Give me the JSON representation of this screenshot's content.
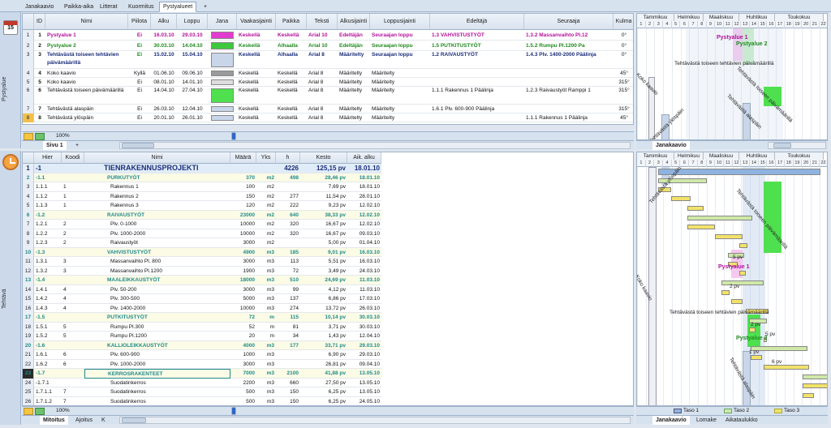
{
  "tabs": [
    "Janakaavio",
    "Paikka-aika",
    "Litterat",
    "Kuormitus",
    "Pystyalueet",
    "+"
  ],
  "active_tab": "Pystyalueet",
  "top_panel": {
    "side_label": "Pystyalue",
    "columns": [
      "ID",
      "Nimi",
      "Piilota",
      "Alku",
      "Loppu",
      "Jana",
      "Vaakasijainti",
      "Paikka",
      "Teksti",
      "Alkusijainti",
      "Loppusijainti",
      "Edeltäjä",
      "Seuraaja",
      "Kulma"
    ],
    "rows": [
      {
        "num": "1",
        "id": "1",
        "name": "Pystyalue 1",
        "hide": "Ei",
        "start": "16.03.10",
        "end": "29.03.10",
        "hpos": "Keskellä",
        "place": "Keskellä",
        "text": "Arial 10",
        "startpos": "Edeltäjän",
        "endpos": "Seuraajan loppu",
        "pred": "1.3  VAHVISTUSTYÖT",
        "succ": "1.3.2  Massanvaihto Pl.12",
        "angle": "0°",
        "style": "magenta",
        "jana": "#e23bd0"
      },
      {
        "num": "2",
        "id": "2",
        "name": "Pystyalue 2",
        "hide": "Ei",
        "start": "30.03.10",
        "end": "14.04.10",
        "hpos": "Keskellä",
        "place": "Alhaalla",
        "text": "Arial 10",
        "startpos": "Edeltäjän",
        "endpos": "Seuraajan loppu",
        "pred": "1.5  PUTKITUSTYÖT",
        "succ": "1.5.2  Rumpu Pl.1200  Pa",
        "angle": "0°",
        "style": "green",
        "jana": "#3ec83e"
      },
      {
        "num": "3",
        "id": "3",
        "name": "Tehtävästä toiseen tehtävien päivämäärillä",
        "hide": "Ei",
        "start": "15.02.10",
        "end": "15.04.10",
        "hpos": "Keskellä",
        "place": "Alhaalla",
        "text": "Arial 8",
        "startpos": "Määritelty",
        "endpos": "Seuraajan loppu",
        "pred": "1.2  RAIVAUSTYÖT",
        "succ": "1.4.3  Plv. 1400-2000  Päälinja",
        "angle": "0°",
        "style": "navy",
        "jana": "#c9d6ea"
      },
      {
        "num": "4",
        "id": "4",
        "name": "Koko kaavio",
        "hide": "Kyllä",
        "start": "01.06.10",
        "end": "09.06.10",
        "hpos": "Keskellä",
        "place": "Keskellä",
        "text": "Arial 8",
        "startpos": "Määritelty",
        "endpos": "Määritelty",
        "pred": "",
        "succ": "",
        "angle": "45°",
        "style": "",
        "jana": "#9a9a9a"
      },
      {
        "num": "5",
        "id": "5",
        "name": "Koko kaavio",
        "hide": "Ei",
        "start": "08.01.10",
        "end": "14.01.10",
        "hpos": "Keskellä",
        "place": "Keskellä",
        "text": "Arial 8",
        "startpos": "Määritelty",
        "endpos": "Määritelty",
        "pred": "",
        "succ": "",
        "angle": "315°",
        "style": "",
        "jana": "#ddd"
      },
      {
        "num": "6",
        "id": "6",
        "name": "Tehtävästä toiseen päivämäärillä",
        "hide": "Ei",
        "start": "14.04.10",
        "end": "27.04.10",
        "hpos": "Keskellä",
        "place": "Keskellä",
        "text": "Arial 8",
        "startpos": "Määritelty",
        "endpos": "Määritelty",
        "pred": "1.1.1  Rakennus 1  Päälinja",
        "succ": "1.2.3  Raivaustyöt  Ramppi 1",
        "angle": "315°",
        "style": "",
        "jana": "#4fe04f"
      },
      {
        "num": "7",
        "id": "7",
        "name": "Tehtävästä alaspäin",
        "hide": "Ei",
        "start": "26.03.10",
        "end": "12.04.10",
        "hpos": "Keskellä",
        "place": "Keskellä",
        "text": "Arial 8",
        "startpos": "Määritelty",
        "endpos": "Määritelty",
        "pred": "1.6.1  Plv. 600-900  Päälinja",
        "succ": "",
        "angle": "315°",
        "style": "",
        "jana": "#c9d6ea"
      },
      {
        "num": "8",
        "id": "8",
        "name": "Tehtävästä ylöspäin",
        "hide": "Ei",
        "start": "20.01.10",
        "end": "26.01.10",
        "hpos": "Keskellä",
        "place": "Keskellä",
        "text": "Arial 8",
        "startpos": "Määritelty",
        "endpos": "Määritelty",
        "pred": "",
        "succ": "1.1.1  Rakennus 1  Päälinja",
        "angle": "45°",
        "style": "",
        "jana": "#c9d6ea"
      }
    ],
    "zoom": "100%",
    "sheet_tab": "Sivu 1"
  },
  "top_gantt": {
    "months": [
      "Tammikuu",
      "Helmikuu",
      "Maaliskuu",
      "Huhtikuu",
      "Toukokuu"
    ],
    "weeks": [
      "1",
      "2",
      "3",
      "4",
      "5",
      "6",
      "7",
      "8",
      "9",
      "10",
      "11",
      "12",
      "13",
      "14",
      "15",
      "16",
      "17",
      "18",
      "19",
      "20",
      "21",
      "22"
    ],
    "labels": {
      "p1": "Pystyalue 1",
      "p2": "Pystyalue 2",
      "t3": "Tehtävästä toiseen tehtävien päivämäärillä",
      "kk": "Koko kaavio",
      "ty": "Tehtävästä ylöspäin",
      "ta": "Tehtävästä alaspäin",
      "tp": "Tehtävästä toiseen päivämäärillä"
    },
    "tab": "Janakaavio"
  },
  "bottom_panel": {
    "side_label": "Tehtävä",
    "columns": [
      "Hier",
      "Koodi",
      "Nimi",
      "Määrä",
      "Yks",
      "h",
      "Kesto",
      "Aik. alku"
    ],
    "rows": [
      {
        "num": "1",
        "hier": "-1",
        "code": "",
        "name": "TIENRAKENNUSPROJEKTI",
        "qty": "",
        "unit": "",
        "h": "4226",
        "dur": "125,15 pv",
        "start": "18.01.10",
        "lvl": 0
      },
      {
        "num": "2",
        "hier": "-1.1",
        "code": "",
        "name": "PURKUTYÖT",
        "qty": "370",
        "unit": "m2",
        "h": "498",
        "dur": "28,46 pv",
        "start": "18.01.10",
        "lvl": 1
      },
      {
        "num": "3",
        "hier": "1.1.1",
        "code": "1",
        "name": "Rakennus 1",
        "qty": "100",
        "unit": "m2",
        "h": "",
        "dur": "7,69 pv",
        "start": "18.01.10",
        "lvl": 2
      },
      {
        "num": "4",
        "hier": "1.1.2",
        "code": "1",
        "name": "Rakennus 2",
        "qty": "150",
        "unit": "m2",
        "h": "277",
        "dur": "11,54 pv",
        "start": "28.01.10",
        "lvl": 2
      },
      {
        "num": "5",
        "hier": "1.1.3",
        "code": "1",
        "name": "Rakennus 3",
        "qty": "120",
        "unit": "m2",
        "h": "222",
        "dur": "9,23 pv",
        "start": "12.02.10",
        "lvl": 2
      },
      {
        "num": "6",
        "hier": "-1.2",
        "code": "",
        "name": "RAIVAUSTYÖT",
        "qty": "23000",
        "unit": "m2",
        "h": "640",
        "dur": "38,33 pv",
        "start": "12.02.10",
        "lvl": 1
      },
      {
        "num": "7",
        "hier": "1.2.1",
        "code": "2",
        "name": "Plv. 0-1000",
        "qty": "10000",
        "unit": "m2",
        "h": "320",
        "dur": "16,67 pv",
        "start": "12.02.10",
        "lvl": 2
      },
      {
        "num": "8",
        "hier": "1.2.2",
        "code": "2",
        "name": "Plv. 1000-2000",
        "qty": "10000",
        "unit": "m2",
        "h": "320",
        "dur": "16,67 pv",
        "start": "09.03.10",
        "lvl": 2
      },
      {
        "num": "9",
        "hier": "1.2.3",
        "code": "2",
        "name": "Raivaustyöt",
        "qty": "3000",
        "unit": "m2",
        "h": "",
        "dur": "5,00 pv",
        "start": "01.04.10",
        "lvl": 2
      },
      {
        "num": "10",
        "hier": "-1.3",
        "code": "",
        "name": "VAHVISTUSTYÖT",
        "qty": "4900",
        "unit": "m3",
        "h": "185",
        "dur": "9,01 pv",
        "start": "16.03.10",
        "lvl": 1
      },
      {
        "num": "11",
        "hier": "1.3.1",
        "code": "3",
        "name": "Massanvaihto Pl. 800",
        "qty": "3000",
        "unit": "m3",
        "h": "113",
        "dur": "5,51 pv",
        "start": "16.03.10",
        "lvl": 2
      },
      {
        "num": "12",
        "hier": "1.3.2",
        "code": "3",
        "name": "Massanvaihto Pl.1200",
        "qty": "1900",
        "unit": "m3",
        "h": "72",
        "dur": "3,49 pv",
        "start": "24.03.10",
        "lvl": 2
      },
      {
        "num": "13",
        "hier": "-1.4",
        "code": "",
        "name": "MAALEIKKAUSTYÖT",
        "qty": "18000",
        "unit": "m3",
        "h": "510",
        "dur": "24,69 pv",
        "start": "11.03.10",
        "lvl": 1
      },
      {
        "num": "14",
        "hier": "1.4.1",
        "code": "4",
        "name": "Plv. 50-200",
        "qty": "3000",
        "unit": "m3",
        "h": "99",
        "dur": "4,12 pv",
        "start": "11.03.10",
        "lvl": 2
      },
      {
        "num": "15",
        "hier": "1.4.2",
        "code": "4",
        "name": "Plv. 300-500",
        "qty": "5000",
        "unit": "m3",
        "h": "137",
        "dur": "6,86 pv",
        "start": "17.03.10",
        "lvl": 2
      },
      {
        "num": "16",
        "hier": "1.4.3",
        "code": "4",
        "name": "Plv. 1400-2000",
        "qty": "10000",
        "unit": "m3",
        "h": "274",
        "dur": "13,72 pv",
        "start": "26.03.10",
        "lvl": 2
      },
      {
        "num": "17",
        "hier": "-1.5",
        "code": "",
        "name": "PUTKITUSTYÖT",
        "qty": "72",
        "unit": "m",
        "h": "115",
        "dur": "10,14 pv",
        "start": "30.03.10",
        "lvl": 1
      },
      {
        "num": "18",
        "hier": "1.5.1",
        "code": "5",
        "name": "Rumpu Pl.300",
        "qty": "52",
        "unit": "m",
        "h": "81",
        "dur": "3,71 pv",
        "start": "30.03.10",
        "lvl": 2
      },
      {
        "num": "19",
        "hier": "1.5.2",
        "code": "5",
        "name": "Rumpu Pl.1200",
        "qty": "20",
        "unit": "m",
        "h": "34",
        "dur": "1,43 pv",
        "start": "12.04.10",
        "lvl": 2
      },
      {
        "num": "20",
        "hier": "-1.6",
        "code": "",
        "name": "KALLIOLEIKKAUSTYÖT",
        "qty": "4000",
        "unit": "m3",
        "h": "177",
        "dur": "33,71 pv",
        "start": "29.03.10",
        "lvl": 1
      },
      {
        "num": "21",
        "hier": "1.6.1",
        "code": "6",
        "name": "Plv. 600-900",
        "qty": "1000",
        "unit": "m3",
        "h": "",
        "dur": "6,90 pv",
        "start": "29.03.10",
        "lvl": 2
      },
      {
        "num": "22",
        "hier": "1.6.2",
        "code": "6",
        "name": "Plv. 1000-2000",
        "qty": "3000",
        "unit": "m3",
        "h": "",
        "dur": "26,81 pv",
        "start": "09.04.10",
        "lvl": 2
      },
      {
        "num": "23",
        "hier": "-1.7",
        "code": "",
        "name": "KERROSRAKENTEET",
        "qty": "7000",
        "unit": "m3",
        "h": "2100",
        "dur": "41,88 pv",
        "start": "13.05.10",
        "lvl": 1
      },
      {
        "num": "24",
        "hier": "-1.7.1",
        "code": "",
        "name": "Suodatinkerros",
        "qty": "2200",
        "unit": "m3",
        "h": "660",
        "dur": "27,50 pv",
        "start": "13.05.10",
        "lvl": 2
      },
      {
        "num": "25",
        "hier": "1.7.1.1",
        "code": "7",
        "name": "Suodatinkerros",
        "qty": "500",
        "unit": "m3",
        "h": "150",
        "dur": "6,25 pv",
        "start": "13.05.10",
        "lvl": 3
      },
      {
        "num": "26",
        "hier": "1.7.1.2",
        "code": "7",
        "name": "Suodatinkerros",
        "qty": "500",
        "unit": "m3",
        "h": "150",
        "dur": "6,25 pv",
        "start": "24.05.10",
        "lvl": 3
      }
    ],
    "zoom": "100%",
    "bottom_tabs": [
      "Mitoitus",
      "Ajoitus",
      "K"
    ]
  },
  "bottom_gantt": {
    "months": [
      "Tammikuu",
      "Helmikuu",
      "Maaliskuu",
      "Huhtikuu",
      "Toukokuu"
    ],
    "weeks": [
      "1",
      "2",
      "3",
      "4",
      "5",
      "6",
      "7",
      "8",
      "9",
      "10",
      "11",
      "12",
      "13",
      "14",
      "15",
      "16",
      "17",
      "18",
      "19",
      "20",
      "21",
      "22"
    ],
    "labels": {
      "p1": "Pystyalue 1",
      "p2": "Pystyalue 2",
      "t3": "Tehtävästä toiseen tehtävien päivämäärillä",
      "kk": "Koko kaavio",
      "ty": "Tehtävästä ylöspäin",
      "ta": "Tehtävästä alaspäin",
      "tp": "Tehtävästä toiseen päivämäärillä",
      "pv5": "5 pv",
      "pv2": "2 pv",
      "pv2b": "2 pv",
      "pv5b": "5 pv",
      "pv1": "1 pv",
      "pv6": "6 pv"
    },
    "legend": [
      "Taso 1",
      "Taso 2",
      "Taso 3"
    ],
    "tabs": [
      "Janakaavio",
      "Lomake",
      "Aikataulukko"
    ]
  },
  "colors": {
    "level1": "#1f8a8a",
    "level0": "#1b2d7a",
    "bar_yellow": "#f2e26a",
    "bar_green": "#cfe8a8",
    "bar_blue": "#8fb3e0",
    "pink": "#e23bd0",
    "green": "#3ec83e"
  }
}
